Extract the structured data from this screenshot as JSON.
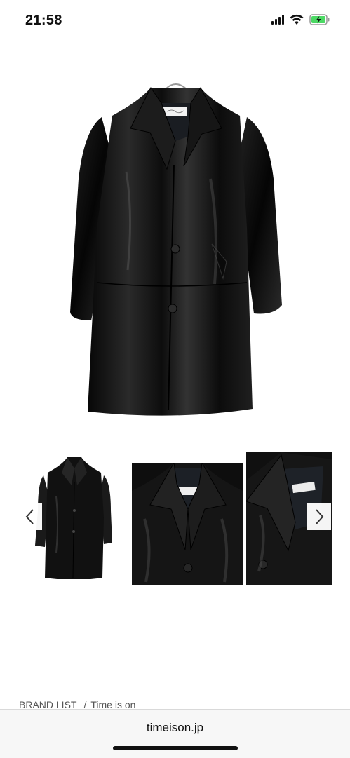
{
  "status_bar": {
    "time": "21:58",
    "icons": [
      "signal-icon",
      "wifi-icon",
      "battery-charging-icon"
    ],
    "battery_color": "#4cd964"
  },
  "product": {
    "main_image": "black-leather-coat",
    "thumbnails": [
      "coat-front-thumbnail",
      "coat-collar-thumbnail",
      "coat-collar-detail-thumbnail"
    ]
  },
  "carousel": {
    "prev_icon": "chevron-left-icon",
    "next_icon": "chevron-right-icon"
  },
  "breadcrumb": {
    "items": [
      "BRAND LIST",
      "Time is on"
    ],
    "separator": "/"
  },
  "browser": {
    "domain": "timeison.jp"
  }
}
